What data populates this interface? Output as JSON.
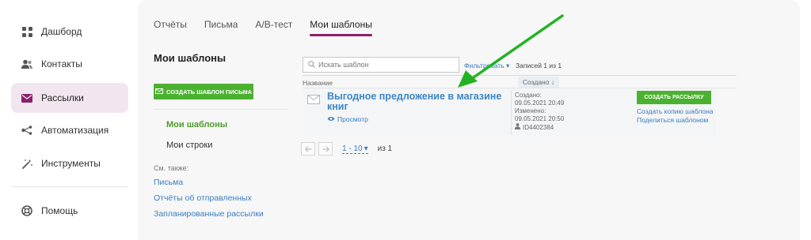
{
  "sidebar": {
    "items": [
      {
        "label": "Дашборд",
        "icon": "grid-icon"
      },
      {
        "label": "Контакты",
        "icon": "contacts-icon"
      },
      {
        "label": "Рассылки",
        "icon": "mail-icon",
        "active": true
      },
      {
        "label": "Автоматизация",
        "icon": "automation-icon"
      },
      {
        "label": "Инструменты",
        "icon": "magic-wand-icon"
      },
      {
        "label": "Помощь",
        "icon": "help-icon"
      }
    ]
  },
  "tabs": [
    {
      "label": "Отчёты"
    },
    {
      "label": "Письма"
    },
    {
      "label": "A/B-тест"
    },
    {
      "label": "Мои шаблоны",
      "active": true
    }
  ],
  "left_panel": {
    "title": "Мои шаблоны",
    "create_button": "СОЗДАТЬ ШАБЛОН ПИСЬМА",
    "links": [
      "Мои шаблоны",
      "Мои строки"
    ],
    "see_also_label": "См. также:",
    "see_also_links": [
      "Письма",
      "Отчёты об отправленных",
      "Запланированные рассылки"
    ]
  },
  "toolbar": {
    "search_placeholder": "Искать шаблон",
    "filter_label": "Фильтровать",
    "records_text": "Записей 1 из 1"
  },
  "table": {
    "col_name": "Название",
    "col_created_sort": "Создано ↓",
    "rows": [
      {
        "title": "Выгодное предложение в магазине книг",
        "preview_label": "Просмотр",
        "created_label": "Создано:",
        "created_value": "09.05.2021 20:49",
        "changed_label": "Изменено:",
        "changed_value": "09.05.2021 20:50",
        "id": "ID4402384",
        "send_button": "СОЗДАТЬ РАССЫЛКУ",
        "copy_link": "Создать копию шаблона",
        "share_link": "Поделиться шаблоном"
      }
    ]
  },
  "pager": {
    "page_size": "1 - 10",
    "of_text": "из 1"
  },
  "colors": {
    "accent": "#8a1f6b",
    "active_nav_bg": "#f1e6f0",
    "button_green": "#4bb130",
    "link_blue": "#3a7cbf",
    "annotation_arrow": "#22b322"
  }
}
